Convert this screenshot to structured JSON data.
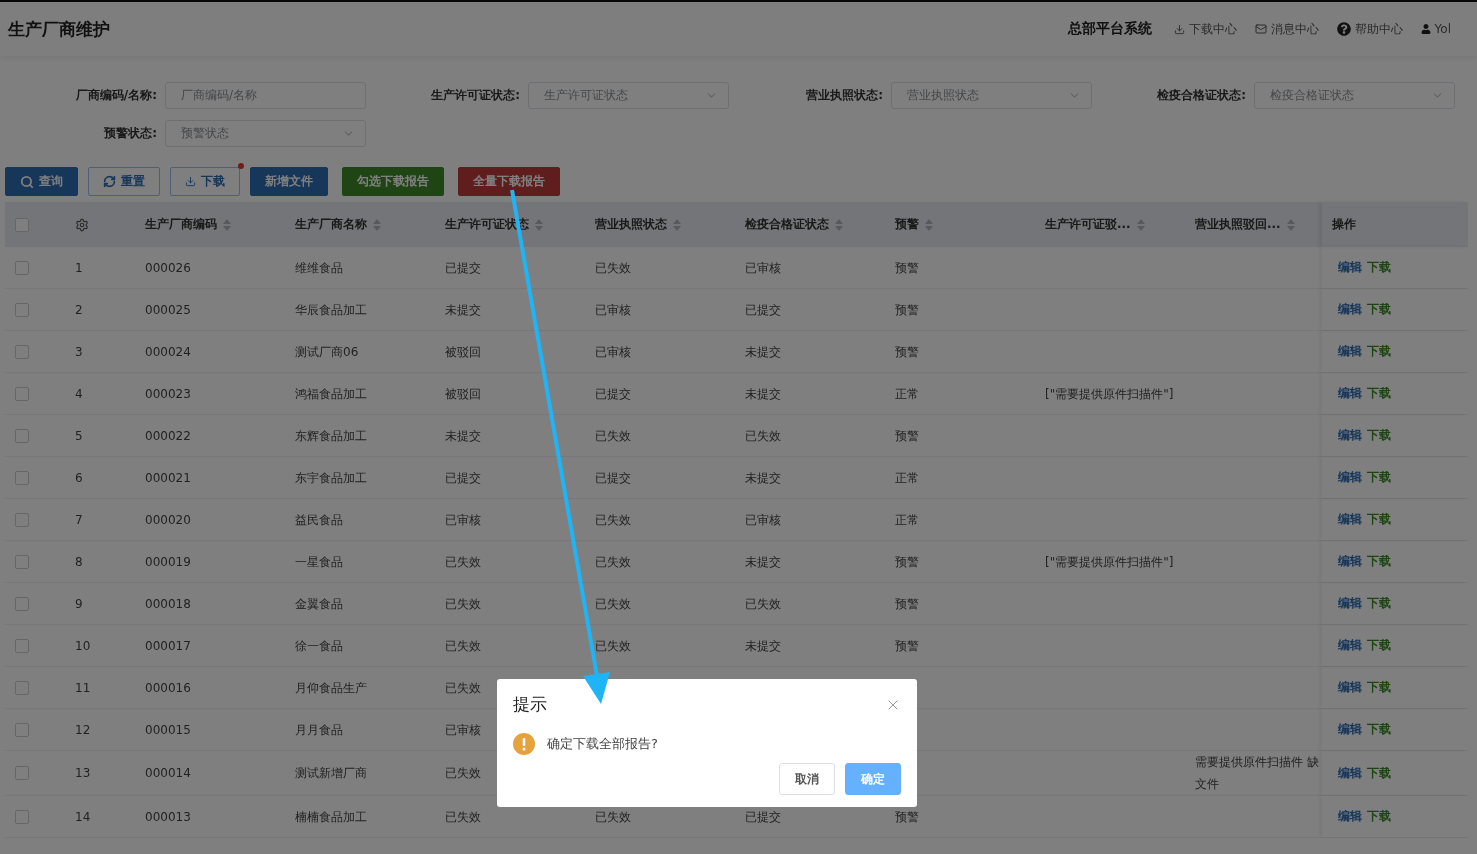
{
  "header": {
    "title": "生产厂商维护",
    "system_name": "总部平台系统",
    "links": [
      {
        "kind": "download",
        "label": "下载中心"
      },
      {
        "kind": "message",
        "label": "消息中心"
      },
      {
        "kind": "help",
        "label": "帮助中心"
      },
      {
        "kind": "user",
        "label": "Yol"
      }
    ]
  },
  "filters": [
    {
      "kind": "input",
      "label": "厂商编码/名称:",
      "placeholder": "厂商编码/名称"
    },
    {
      "kind": "select",
      "label": "生产许可证状态:",
      "placeholder": "生产许可证状态"
    },
    {
      "kind": "select",
      "label": "营业执照状态:",
      "placeholder": "营业执照状态"
    },
    {
      "kind": "select",
      "label": "检疫合格证状态:",
      "placeholder": "检疫合格证状态"
    },
    {
      "kind": "select",
      "label": "预警状态:",
      "placeholder": "预警状态"
    }
  ],
  "toolbar": [
    {
      "kind": "query",
      "label": "查询",
      "dot": false
    },
    {
      "kind": "reset",
      "label": "重置",
      "dot": false
    },
    {
      "kind": "download",
      "label": "下载",
      "dot": true
    },
    {
      "kind": "add",
      "label": "新增文件",
      "dot": false
    },
    {
      "kind": "pick-download",
      "label": "勾选下载报告",
      "dot": false
    },
    {
      "kind": "all-download",
      "label": "全量下载报告",
      "dot": false
    }
  ],
  "table": {
    "select_all_checked": false,
    "columns": [
      {
        "label": "生产厂商编码",
        "sortable": true
      },
      {
        "label": "生产厂商名称",
        "sortable": true
      },
      {
        "label": "生产许可证状态",
        "sortable": true
      },
      {
        "label": "营业执照状态",
        "sortable": true
      },
      {
        "label": "检疫合格证状态",
        "sortable": true
      },
      {
        "label": "预警",
        "sortable": true
      },
      {
        "label": "生产许可证驳...",
        "sortable": true
      },
      {
        "label": "营业执照驳回...",
        "sortable": true
      },
      {
        "label": "操作",
        "sortable": false
      }
    ],
    "rows": [
      {
        "checked": false,
        "index": "1",
        "cells": [
          "000026",
          "维维食品",
          "已提交",
          "已失效",
          "已审核",
          "预警",
          null,
          null
        ],
        "actions": [
          "编辑",
          "下载"
        ]
      },
      {
        "checked": false,
        "index": "2",
        "cells": [
          "000025",
          "华辰食品加工",
          "未提交",
          "已审核",
          "已提交",
          "预警",
          null,
          null
        ],
        "actions": [
          "编辑",
          "下载"
        ]
      },
      {
        "checked": false,
        "index": "3",
        "cells": [
          "000024",
          "测试厂商06",
          "被驳回",
          "已审核",
          "未提交",
          "预警",
          null,
          null
        ],
        "actions": [
          "编辑",
          "下载"
        ]
      },
      {
        "checked": false,
        "index": "4",
        "cells": [
          "000023",
          "鸿福食品加工",
          "被驳回",
          "已提交",
          "未提交",
          "正常",
          "[\"需要提供原件扫描件\"]",
          null
        ],
        "actions": [
          "编辑",
          "下载"
        ]
      },
      {
        "checked": false,
        "index": "5",
        "cells": [
          "000022",
          "东辉食品加工",
          "未提交",
          "已失效",
          "已失效",
          "预警",
          null,
          null
        ],
        "actions": [
          "编辑",
          "下载"
        ]
      },
      {
        "checked": false,
        "index": "6",
        "cells": [
          "000021",
          "东宇食品加工",
          "已提交",
          "已提交",
          "未提交",
          "正常",
          null,
          null
        ],
        "actions": [
          "编辑",
          "下载"
        ]
      },
      {
        "checked": false,
        "index": "7",
        "cells": [
          "000020",
          "益民食品",
          "已审核",
          "已失效",
          "已审核",
          "正常",
          null,
          null
        ],
        "actions": [
          "编辑",
          "下载"
        ]
      },
      {
        "checked": false,
        "index": "8",
        "cells": [
          "000019",
          "一星食品",
          "已失效",
          "已失效",
          "未提交",
          "预警",
          "[\"需要提供原件扫描件\"]",
          null
        ],
        "actions": [
          "编辑",
          "下载"
        ]
      },
      {
        "checked": false,
        "index": "9",
        "cells": [
          "000018",
          "金翼食品",
          "已失效",
          "已失效",
          "已失效",
          "预警",
          null,
          null
        ],
        "actions": [
          "编辑",
          "下载"
        ]
      },
      {
        "checked": false,
        "index": "10",
        "cells": [
          "000017",
          "徐一食品",
          "已失效",
          "已失效",
          "未提交",
          "预警",
          null,
          null
        ],
        "actions": [
          "编辑",
          "下载"
        ]
      },
      {
        "checked": false,
        "index": "11",
        "cells": [
          "000016",
          "月仰食品生产",
          "已失效",
          null,
          null,
          null,
          null,
          null
        ],
        "actions": [
          "编辑",
          "下载"
        ]
      },
      {
        "checked": false,
        "index": "12",
        "cells": [
          "000015",
          "月月食品",
          "已审核",
          null,
          null,
          null,
          null,
          null
        ],
        "actions": [
          "编辑",
          "下载"
        ]
      },
      {
        "checked": false,
        "index": "13",
        "cells": [
          "000014",
          "测试新增厂商",
          "已失效",
          null,
          null,
          null,
          null,
          "需要提供原件扫描件 缺文件"
        ],
        "actions": [
          "编辑",
          "下载"
        ]
      },
      {
        "checked": false,
        "index": "14",
        "cells": [
          "000013",
          "楠楠食品加工",
          "已失效",
          "已失效",
          "已提交",
          "预警",
          null,
          null
        ],
        "actions": [
          "编辑",
          "下载"
        ]
      }
    ]
  },
  "dialog": {
    "title": "提示",
    "message": "确定下载全部报告?",
    "buttons": [
      {
        "kind": "default",
        "label": "取消"
      },
      {
        "kind": "primary",
        "label": "确定"
      }
    ]
  }
}
